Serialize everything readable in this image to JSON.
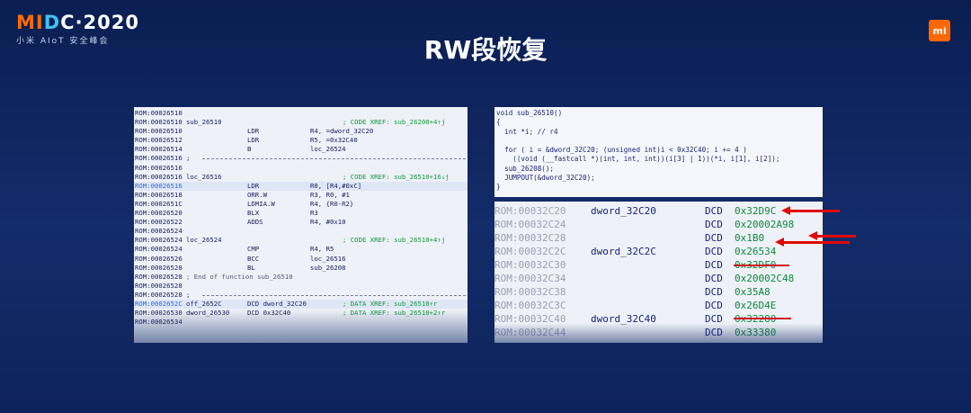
{
  "header": {
    "logo_main_prefix": "MI",
    "logo_main_mid": "D",
    "logo_main_suffix": "C·2020",
    "logo_sub": "小米 AIoT 安全峰会",
    "mi_badge": "mi",
    "title": "RW段恢复"
  },
  "colors": {
    "accent_orange": "#ff6700",
    "arrow_red": "#e10a0a",
    "hex_green": "#0e8a3c"
  },
  "asm_lines": [
    {
      "addr": "ROM:00026510",
      "label": "",
      "op": "",
      "arg": "",
      "comment": "",
      "hl": false,
      "sep": false,
      "end": ""
    },
    {
      "addr": "ROM:00026510",
      "label": "sub_26510",
      "op": "",
      "arg": "",
      "comment": "; CODE XREF: sub_26200+4↑j",
      "hl": false,
      "sep": false,
      "end": ""
    },
    {
      "addr": "ROM:00026510",
      "label": "",
      "op": "LDR",
      "arg": "R4, =dword_32C20",
      "comment": "",
      "hl": false,
      "sep": false,
      "end": ""
    },
    {
      "addr": "ROM:00026512",
      "label": "",
      "op": "LDR",
      "arg": "R5, =0x32C40",
      "comment": "",
      "hl": false,
      "sep": false,
      "end": ""
    },
    {
      "addr": "ROM:00026514",
      "label": "",
      "op": "B",
      "arg": "loc_26524",
      "comment": "",
      "hl": false,
      "sep": false,
      "end": ""
    },
    {
      "addr": "ROM:00026516",
      "label": ";",
      "op": "",
      "arg": "",
      "comment": "",
      "hl": false,
      "sep": true,
      "end": ""
    },
    {
      "addr": "ROM:00026516",
      "label": "",
      "op": "",
      "arg": "",
      "comment": "",
      "hl": false,
      "sep": false,
      "end": ""
    },
    {
      "addr": "ROM:00026516",
      "label": "loc_26516",
      "op": "",
      "arg": "",
      "comment": "; CODE XREF: sub_26510+16↓j",
      "hl": false,
      "sep": false,
      "end": ""
    },
    {
      "addr": "ROM:00026516",
      "label": "",
      "op": "LDR",
      "arg": "R0, [R4,#0xC]",
      "comment": "",
      "hl": true,
      "sep": false,
      "end": ""
    },
    {
      "addr": "ROM:00026518",
      "label": "",
      "op": "ORR.W",
      "arg": "R3, R0, #1",
      "comment": "",
      "hl": false,
      "sep": false,
      "end": ""
    },
    {
      "addr": "ROM:0002651C",
      "label": "",
      "op": "LDMIA.W",
      "arg": "R4, {R0-R2}",
      "comment": "",
      "hl": false,
      "sep": false,
      "end": ""
    },
    {
      "addr": "ROM:00026520",
      "label": "",
      "op": "BLX",
      "arg": "R3",
      "comment": "",
      "hl": false,
      "sep": false,
      "end": ""
    },
    {
      "addr": "ROM:00026522",
      "label": "",
      "op": "ADDS",
      "arg": "R4, #0x10",
      "comment": "",
      "hl": false,
      "sep": false,
      "end": ""
    },
    {
      "addr": "ROM:00026524",
      "label": "",
      "op": "",
      "arg": "",
      "comment": "",
      "hl": false,
      "sep": false,
      "end": ""
    },
    {
      "addr": "ROM:00026524",
      "label": "loc_26524",
      "op": "",
      "arg": "",
      "comment": "; CODE XREF: sub_26510+4↑j",
      "hl": false,
      "sep": false,
      "end": ""
    },
    {
      "addr": "ROM:00026524",
      "label": "",
      "op": "CMP",
      "arg": "R4, R5",
      "comment": "",
      "hl": false,
      "sep": false,
      "end": ""
    },
    {
      "addr": "ROM:00026526",
      "label": "",
      "op": "BCC",
      "arg": "loc_26516",
      "comment": "",
      "hl": false,
      "sep": false,
      "end": ""
    },
    {
      "addr": "ROM:00026528",
      "label": "",
      "op": "BL",
      "arg": "sub_26208",
      "comment": "",
      "hl": false,
      "sep": false,
      "end": ""
    },
    {
      "addr": "ROM:00026528",
      "label": "",
      "op": "",
      "arg": "",
      "comment": "",
      "hl": false,
      "sep": false,
      "end": "; End of function sub_26510"
    },
    {
      "addr": "ROM:00026528",
      "label": "",
      "op": "",
      "arg": "",
      "comment": "",
      "hl": false,
      "sep": false,
      "end": ""
    },
    {
      "addr": "ROM:00026528",
      "label": ";",
      "op": "",
      "arg": "",
      "comment": "",
      "hl": false,
      "sep": true,
      "end": ""
    },
    {
      "addr": "ROM:0002652C",
      "label": "off_2652C",
      "op": "DCD dword_32C20",
      "arg": "",
      "comment": "; DATA XREF: sub_26510↑r",
      "hl": true,
      "sep": false,
      "end": ""
    },
    {
      "addr": "ROM:00026530",
      "label": "dword_26530",
      "op": "DCD 0x32C40",
      "arg": "",
      "comment": "; DATA XREF: sub_26510+2↑r",
      "hl": false,
      "sep": false,
      "end": ""
    },
    {
      "addr": "ROM:00026534",
      "label": "",
      "op": "",
      "arg": "",
      "comment": "",
      "hl": false,
      "sep": false,
      "end": ""
    }
  ],
  "c_code": {
    "lines": [
      "void sub_26510()",
      "{",
      "  int *i; // r4",
      "",
      "  for ( i = &dword_32C20; (unsigned int)i < 0x32C40; i += 4 )",
      "    ((void (__fastcall *)(int, int, int))(i[3] | 1))(*i, i[1], i[2]);",
      "  sub_26208();",
      "  JUMPOUT(&dword_32C20);",
      "}"
    ]
  },
  "data_rows": [
    {
      "addr": "ROM:00032C20",
      "label": "dword_32C20",
      "dcd": "DCD",
      "value": "0x32D9C"
    },
    {
      "addr": "ROM:00032C24",
      "label": "",
      "dcd": "DCD",
      "value": "0x20002A98"
    },
    {
      "addr": "ROM:00032C28",
      "label": "",
      "dcd": "DCD",
      "value": "0x1B0"
    },
    {
      "addr": "ROM:00032C2C",
      "label": "dword_32C2C",
      "dcd": "DCD",
      "value": "0x26534"
    },
    {
      "addr": "ROM:00032C30",
      "label": "",
      "dcd": "DCD",
      "value": "0x32DF0"
    },
    {
      "addr": "ROM:00032C34",
      "label": "",
      "dcd": "DCD",
      "value": "0x20002C48"
    },
    {
      "addr": "ROM:00032C38",
      "label": "",
      "dcd": "DCD",
      "value": "0x35A8"
    },
    {
      "addr": "ROM:00032C3C",
      "label": "",
      "dcd": "DCD",
      "value": "0x26D4E"
    },
    {
      "addr": "ROM:00032C40",
      "label": "dword_32C40",
      "dcd": "DCD",
      "value": "0x32280"
    },
    {
      "addr": "ROM:00032C44",
      "label": "",
      "dcd": "DCD",
      "value": "0x33380"
    }
  ]
}
